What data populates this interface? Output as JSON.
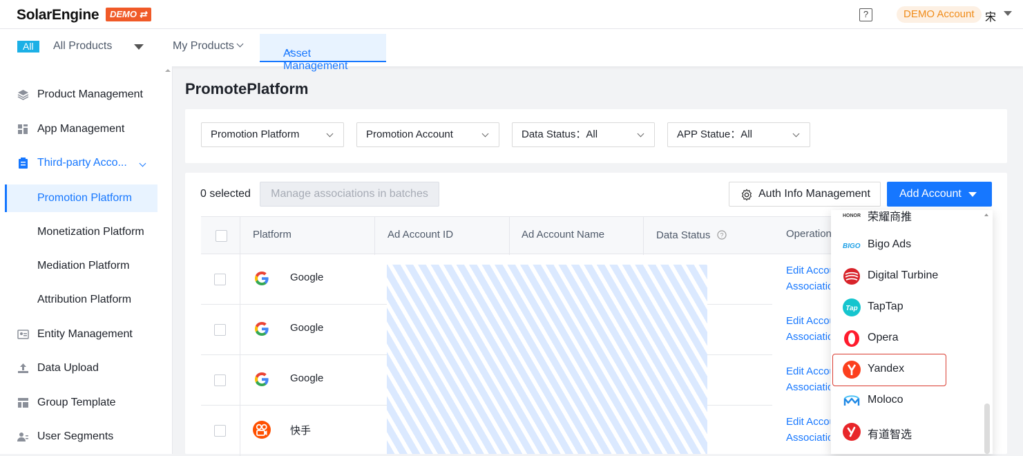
{
  "header": {
    "logo": "SolarEngine",
    "demo_badge": "DEMO ⇄",
    "help": "?",
    "demo_account": "DEMO Account",
    "user": "宋"
  },
  "nav": {
    "all_tag": "All",
    "all_products": "All Products",
    "my_products": "My Products",
    "asset_management": "Asset Management"
  },
  "sidebar": {
    "items": [
      {
        "label": "Product Management",
        "icon": "layers-icon"
      },
      {
        "label": "App Management",
        "icon": "grid-icon"
      },
      {
        "label": "Third-party Acco...",
        "icon": "clipboard-icon"
      },
      {
        "label": "Promotion Platform"
      },
      {
        "label": "Monetization Platform"
      },
      {
        "label": "Mediation Platform"
      },
      {
        "label": "Attribution Platform"
      },
      {
        "label": "Entity Management",
        "icon": "id-card-icon"
      },
      {
        "label": "Data Upload",
        "icon": "upload-icon"
      },
      {
        "label": "Group Template",
        "icon": "template-icon"
      },
      {
        "label": "User Segments",
        "icon": "users-icon"
      }
    ]
  },
  "main": {
    "title": "PromotePlatform",
    "filters": {
      "promotion_platform": "Promotion Platform",
      "promotion_account": "Promotion Account",
      "data_status": "Data Status：All",
      "app_status": "APP Statue：All"
    },
    "toolbar": {
      "selected": "0 selected",
      "batch": "Manage associations in batches",
      "auth": "Auth Info Management",
      "add": "Add Account"
    },
    "table": {
      "headers": [
        "Platform",
        "Ad Account ID",
        "Ad Account Name",
        "Data Status",
        "Operation"
      ],
      "rows": [
        {
          "platform": "Google",
          "edit": "Edit Account",
          "assoc": "Associations"
        },
        {
          "platform": "Google",
          "edit": "Edit Account",
          "assoc": "Associations"
        },
        {
          "platform": "Google",
          "edit": "Edit Account",
          "assoc": "Associations"
        },
        {
          "platform": "快手",
          "edit": "Edit Account",
          "assoc": "Associations"
        }
      ]
    }
  },
  "dropdown": {
    "items": [
      {
        "label": "荣耀商推",
        "icon": "honor-icon"
      },
      {
        "label": "Bigo Ads",
        "icon": "bigo-icon"
      },
      {
        "label": "Digital Turbine",
        "icon": "digital-turbine-icon"
      },
      {
        "label": "TapTap",
        "icon": "taptap-icon"
      },
      {
        "label": "Opera",
        "icon": "opera-icon"
      },
      {
        "label": "Yandex",
        "icon": "yandex-icon"
      },
      {
        "label": "Moloco",
        "icon": "moloco-icon"
      },
      {
        "label": "有道智选",
        "icon": "youdao-icon"
      }
    ]
  },
  "colors": {
    "primary": "#1677ff",
    "demo_orange": "#f05a28",
    "highlight_red": "#d93b30"
  }
}
